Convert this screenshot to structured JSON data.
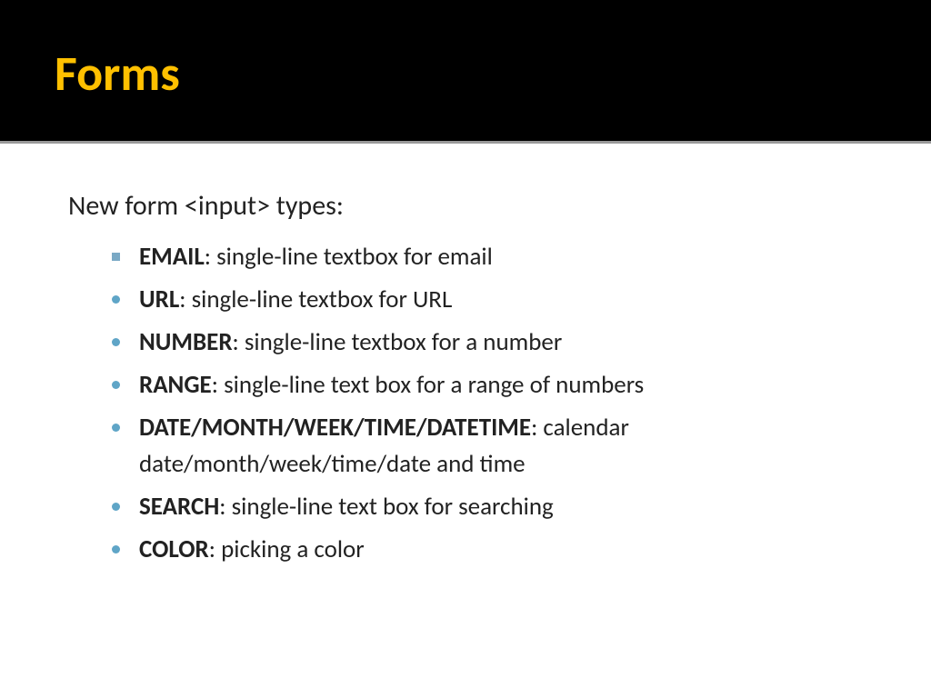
{
  "header": {
    "title": "Forms"
  },
  "content": {
    "intro": "New form <input> types:",
    "items": [
      {
        "term": "EMAIL",
        "desc": ": single-line textbox for email",
        "style": "square"
      },
      {
        "term": "URL",
        "desc": ": single-line textbox for URL",
        "style": "circle"
      },
      {
        "term": "NUMBER",
        "desc": ": single-line textbox for a number",
        "style": "circle"
      },
      {
        "term": "RANGE",
        "desc": ":  single-line text box for a range of numbers",
        "style": "circle"
      },
      {
        "term": "DATE/MONTH/WEEK/TIME/DATETIME",
        "desc": ": calendar date/month/week/time/date and time",
        "style": "circle"
      },
      {
        "term": "SEARCH",
        "desc": ": single-line text box for searching",
        "style": "circle"
      },
      {
        "term": "COLOR",
        "desc": ":  picking a color",
        "style": "circle"
      }
    ]
  }
}
